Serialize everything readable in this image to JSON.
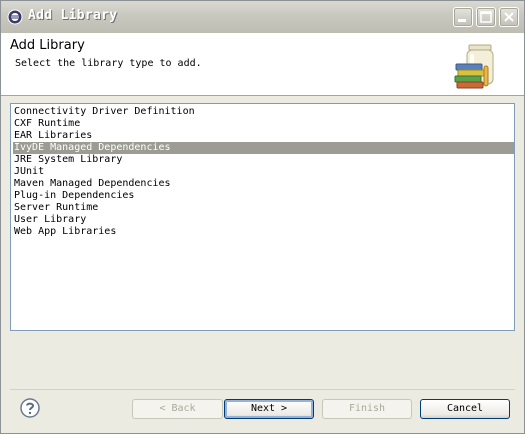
{
  "window": {
    "title": "Add Library",
    "icon": "eclipse-icon",
    "controls": [
      "minimize-icon",
      "maximize-icon",
      "close-icon"
    ]
  },
  "header": {
    "title": "Add Library",
    "description": "Select the library type to add.",
    "image": "library-jar-books-icon"
  },
  "list": {
    "items": [
      "Connectivity Driver Definition",
      "CXF Runtime",
      "EAR Libraries",
      "IvyDE Managed Dependencies",
      "JRE System Library",
      "JUnit",
      "Maven Managed Dependencies",
      "Plug-in Dependencies",
      "Server Runtime",
      "User Library",
      "Web App Libraries"
    ],
    "selected_index": 3,
    "selected_color": "#9c9c94"
  },
  "buttons": {
    "back": "< Back",
    "next": "Next >",
    "finish": "Finish",
    "cancel": "Cancel"
  },
  "help_icon": "help-question-icon"
}
